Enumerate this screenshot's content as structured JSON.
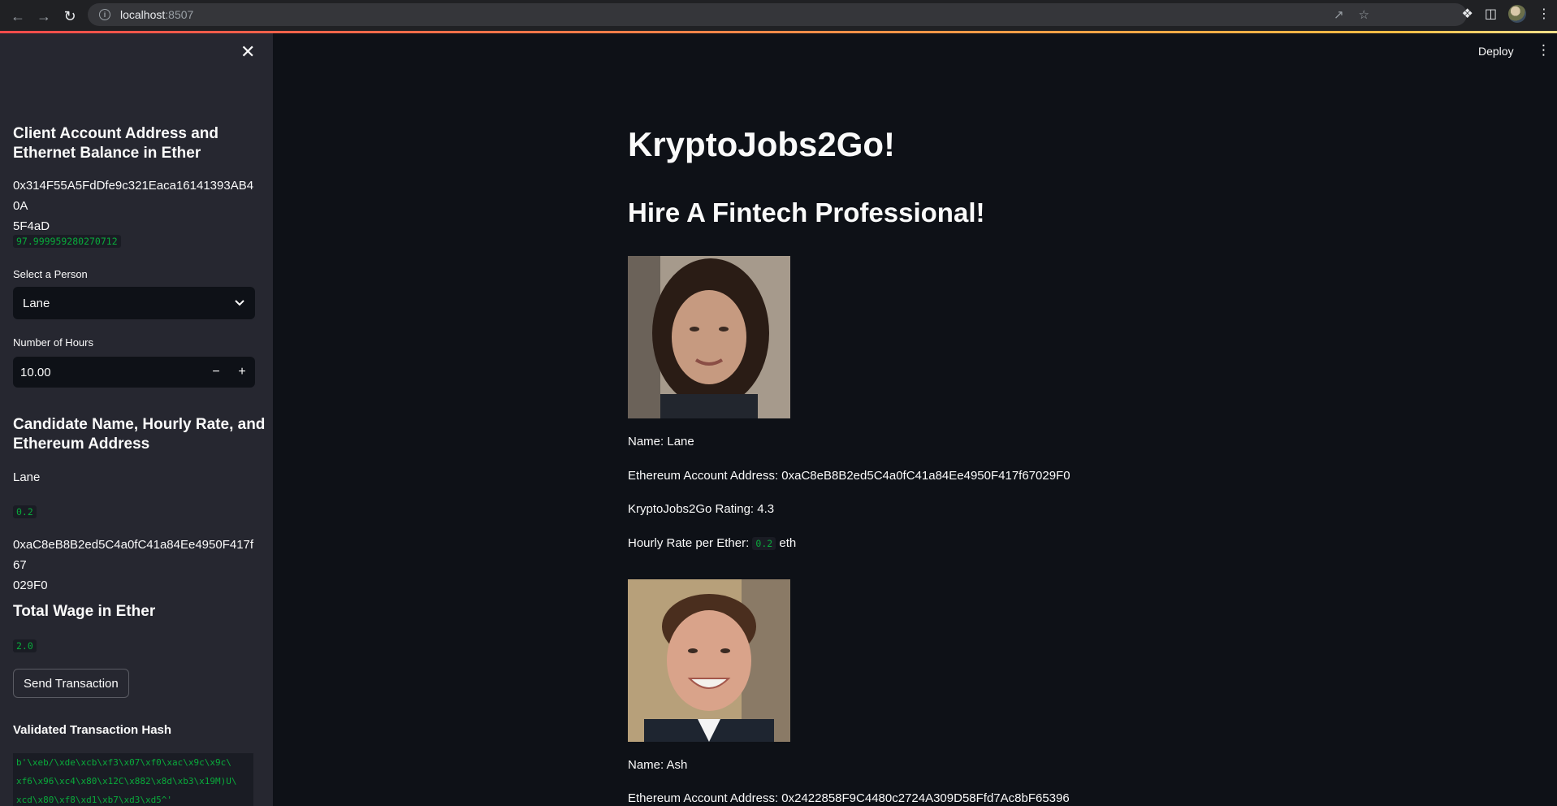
{
  "browser": {
    "host": "localhost",
    "port": ":8507"
  },
  "app": {
    "deploy_label": "Deploy",
    "title": "KryptoJobs2Go!",
    "subtitle": "Hire A Fintech Professional!"
  },
  "sidebar": {
    "account_heading_line1": "Client Account Address and",
    "account_heading_line2": "Ethernet Balance in Ether",
    "account_address_line1": "0x314F55A5FdDfe9c321Eaca16141393AB40A",
    "account_address_line2": "5F4aD",
    "balance": "97.999959280270712",
    "select_label": "Select a Person",
    "select_value": "Lane",
    "hours_label": "Number of Hours",
    "hours_value": "10.00",
    "candidate_heading_line1": "Candidate Name, Hourly Rate, and",
    "candidate_heading_line2": "Ethereum Address",
    "candidate_name": "Lane",
    "candidate_rate": "0.2",
    "candidate_address_line1": "0xaC8eB8B2ed5C4a0fC41a84Ee4950F417f67",
    "candidate_address_line2": "029F0",
    "wage_heading": "Total Wage in Ether",
    "wage_value": "2.0",
    "send_button": "Send Transaction",
    "hash_heading": "Validated Transaction Hash",
    "hash_line1": "b'\\xeb/\\xde\\xcb\\xf3\\x07\\xf0\\xac\\x9c\\x9c\\",
    "hash_line2": "xf6\\x96\\xc4\\x80\\x12C\\x882\\x8d\\xb3\\x19M)U\\",
    "hash_line3": "xcd\\x80\\xf8\\xd1\\xb7\\xd3\\xd5^'"
  },
  "candidates": [
    {
      "name_text": "Name: Lane",
      "address_text": "Ethereum Account Address: 0xaC8eB8B2ed5C4a0fC41a84Ee4950F417f67029F0",
      "rating_text": "KryptoJobs2Go Rating: 4.3",
      "rate_prefix": "Hourly Rate per Ether:",
      "rate_value": "0.2",
      "rate_suffix": "eth"
    },
    {
      "name_text": "Name: Ash",
      "address_text": "Ethereum Account Address: 0x2422858F9C4480c2724A309D58Ffd7Ac8bF65396"
    }
  ],
  "colors": {
    "background": "#0e1117",
    "sidebar": "#262730",
    "code_green": "#09ab3b"
  }
}
